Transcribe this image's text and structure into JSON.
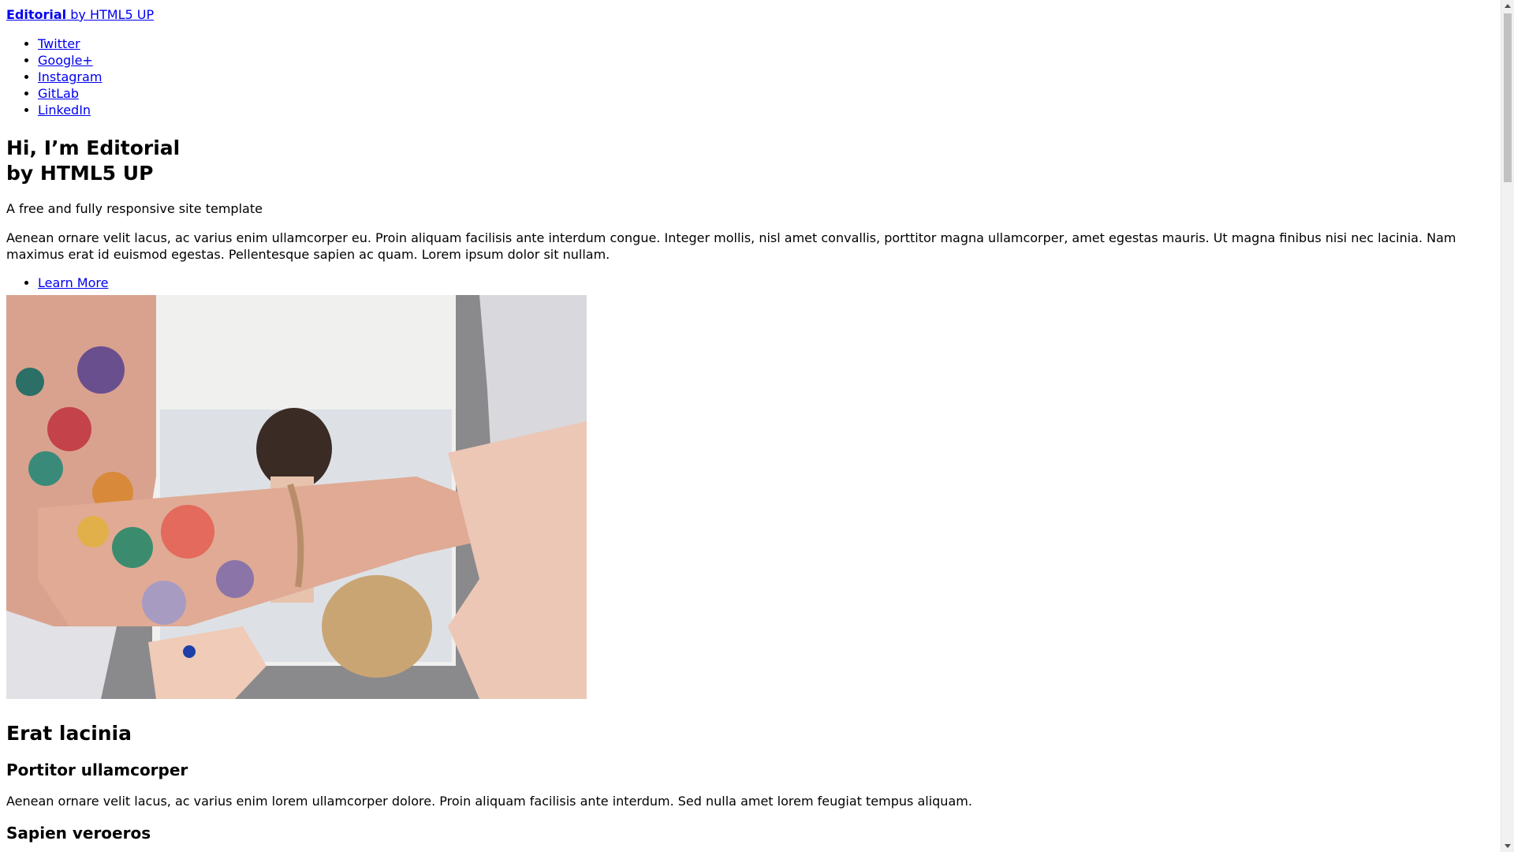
{
  "header": {
    "logo_strong": "Editorial",
    "logo_rest": " by HTML5 UP"
  },
  "social_links": [
    {
      "label": "Twitter"
    },
    {
      "label": "Google+"
    },
    {
      "label": "Instagram"
    },
    {
      "label": "GitLab"
    },
    {
      "label": "LinkedIn"
    }
  ],
  "banner": {
    "title_line1": "Hi, I’m Editorial",
    "title_line2": "by HTML5 UP",
    "subtitle": "A free and fully responsive site template",
    "text": "Aenean ornare velit lacus, ac varius enim ullamcorper eu. Proin aliquam facilisis ante interdum congue. Integer mollis, nisl amet convallis, porttitor magna ullamcorper, amet egestas mauris. Ut magna finibus nisi nec lacinia. Nam maximus erat id euismod egestas. Pellentesque sapien ac quam. Lorem ipsum dolor sit nullam.",
    "action_label": "Learn More"
  },
  "section": {
    "title": "Erat lacinia",
    "features": [
      {
        "title": "Portitor ullamcorper",
        "text": "Aenean ornare velit lacus, ac varius enim lorem ullamcorper dolore. Proin aliquam facilisis ante interdum. Sed nulla amet lorem feugiat tempus aliquam."
      },
      {
        "title": "Sapien veroeros",
        "text": ""
      }
    ]
  },
  "colors": {
    "link": "#0000ee",
    "text": "#000000",
    "background": "#ffffff"
  }
}
